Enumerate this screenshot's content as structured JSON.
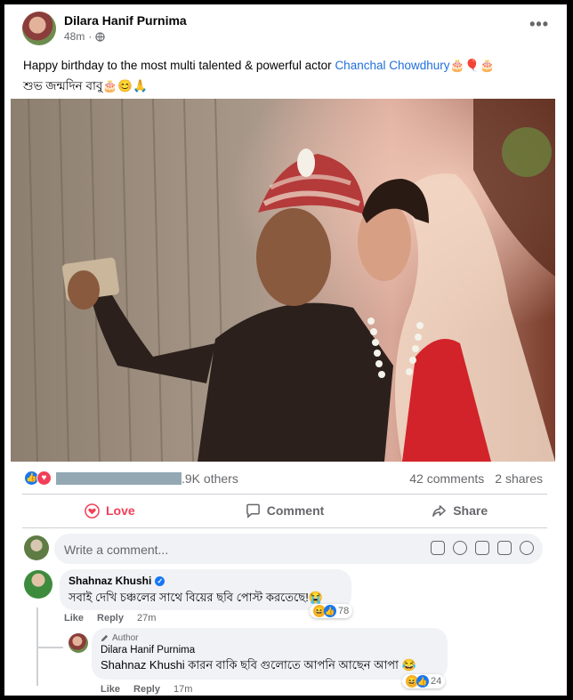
{
  "post": {
    "author": "Dilara Hanif Purnima",
    "time": "48m",
    "audience_icon": "globe-icon",
    "more": "•••",
    "caption_prefix": "Happy birthday to the most multi talented & powerful actor ",
    "caption_link": "Chanchal Chowdhury",
    "caption_emoji": "🎂🎈🎂",
    "caption_line2": "শুভ জন্মদিন বাবু🎂😊🙏"
  },
  "stats": {
    "reaction_icons": [
      "like-icon",
      "love-icon"
    ],
    "others": ".9K others",
    "comments": "42 comments",
    "shares": "2 shares"
  },
  "actions": {
    "love": "Love",
    "comment": "Comment",
    "share": "Share"
  },
  "composer": {
    "placeholder": "Write a comment...",
    "tools": [
      "sticker-icon",
      "emoji-icon",
      "camera-icon",
      "gif-icon",
      "avatar-sticker-icon"
    ]
  },
  "comments": [
    {
      "name": "Shahnaz Khushi",
      "verified": true,
      "text": "সবাই দেখি চঞ্চলের সাথে বিয়ের ছবি পোস্ট করতেছে!😭",
      "like": "Like",
      "reply": "Reply",
      "time": "27m",
      "reaction_count": "78"
    },
    {
      "tag": "Author",
      "name": "Dilara Hanif Purnima",
      "mention": "Shahnaz Khushi",
      "text": " কারন বাকি ছবি গুলোতে আপনি আছেন আপা 😂",
      "like": "Like",
      "reply": "Reply",
      "time": "17m",
      "reaction_count": "24"
    }
  ],
  "colors": {
    "link": "#216fdb",
    "love": "#f33e58",
    "like": "#1877f2",
    "muted": "#65676b"
  }
}
